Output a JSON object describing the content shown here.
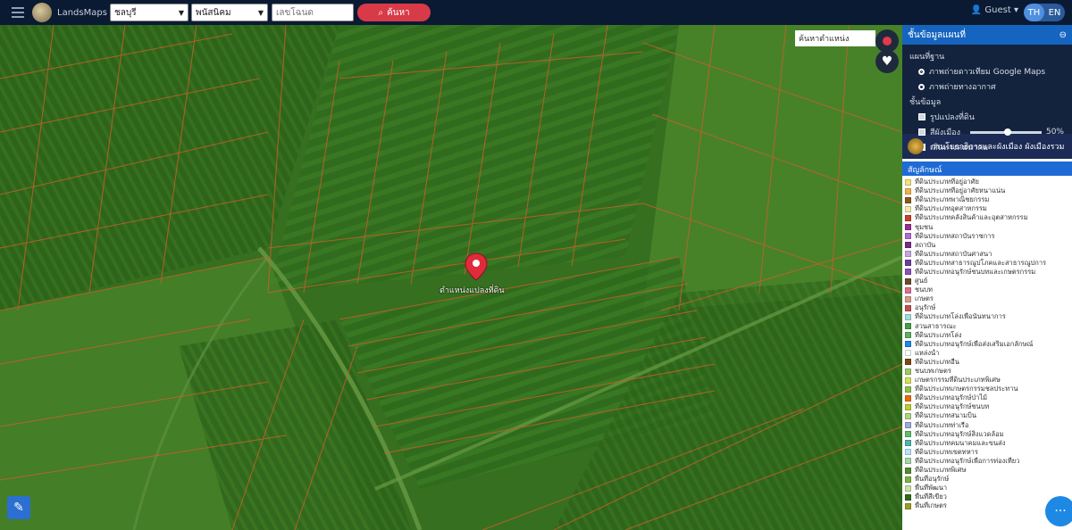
{
  "header": {
    "brand": "LandsMaps",
    "province_select": "ชลบุรี",
    "district_select": "พนัสนิคม",
    "search_placeholder": "เลขโฉนด",
    "search_button": "ค้นหา",
    "user": "Guest",
    "lang_th": "TH",
    "lang_en": "EN"
  },
  "map": {
    "map_search_text": "ค้นหาตำแหน่ง",
    "marker_label": "ตำแหน่งแปลงที่ดิน"
  },
  "panel": {
    "title": "ชั้นข้อมูลแผนที่",
    "basemap_heading": "แผนที่ฐาน",
    "basemap_options": [
      "ภาพถ่ายดาวเทียม Google Maps",
      "ภาพถ่ายทางอากาศ"
    ],
    "layer_heading": "ชั้นข้อมูล",
    "layers": [
      {
        "label": "รูปแปลงที่ดิน",
        "checked": true
      },
      {
        "label": "สีผังเมือง",
        "checked": true,
        "opacity": "50%"
      },
      {
        "label": "เส้นทางคมนาคม",
        "checked": false
      }
    ],
    "banner": "กรมโยธาธิการและผังเมือง ผังเมืองรวม",
    "legend_heading": "สัญลักษณ์",
    "legend": [
      {
        "color": "#f3e37a",
        "label": "ที่ดินประเภทที่อยู่อาศัย"
      },
      {
        "color": "#f0b24a",
        "label": "ที่ดินประเภทที่อยู่อาศัยหนาแน่น"
      },
      {
        "color": "#8a5a1c",
        "label": "ที่ดินประเภทพาณิชยกรรม"
      },
      {
        "color": "#f6e9a8",
        "label": "ที่ดินประเภทอุตสาหกรรม"
      },
      {
        "color": "#c8412b",
        "label": "ที่ดินประเภทคลังสินค้าและอุตสาหกรรม"
      },
      {
        "color": "#9b2f8f",
        "label": "ชุมชน"
      },
      {
        "color": "#b36bd1",
        "label": "ที่ดินประเภทสถาบันราชการ"
      },
      {
        "color": "#7a2a88",
        "label": "สถาบัน"
      },
      {
        "color": "#caa3e6",
        "label": "ที่ดินประเภทสถาบันศาสนา"
      },
      {
        "color": "#6b3f9c",
        "label": "ที่ดินประเภทสาธารณูปโภคและสาธารณูปการ"
      },
      {
        "color": "#8f4fc2",
        "label": "ที่ดินประเภทอนุรักษ์ชนบทและเกษตรกรรม"
      },
      {
        "color": "#6d4b2a",
        "label": "ศูนย์"
      },
      {
        "color": "#e36f8a",
        "label": "ชนบท"
      },
      {
        "color": "#d99a8a",
        "label": "เกษตร"
      },
      {
        "color": "#c65050",
        "label": "อนุรักษ์"
      },
      {
        "color": "#9be0d9",
        "label": "ที่ดินประเภทโล่งเพื่อนันทนาการ"
      },
      {
        "color": "#43a047",
        "label": "สวนสาธารณะ"
      },
      {
        "color": "#5fae5f",
        "label": "ที่ดินประเภทโล่ง"
      },
      {
        "color": "#1e88e5",
        "label": "ที่ดินประเภทอนุรักษ์เพื่อส่งเสริมเอกลักษณ์"
      },
      {
        "color": "#ffffff",
        "label": "แหล่งน้ำ"
      },
      {
        "color": "#7b4a12",
        "label": "ที่ดินประเภทอื่น"
      },
      {
        "color": "#9ccc65",
        "label": "ชนบทเกษตร"
      },
      {
        "color": "#d4e157",
        "label": "เกษตรกรรมที่ดินประเภทพิเศษ"
      },
      {
        "color": "#8bc34a",
        "label": "ที่ดินประเภทเกษตรกรรมชลประทาน"
      },
      {
        "color": "#ef6c00",
        "label": "ที่ดินประเภทอนุรักษ์ป่าไม้"
      },
      {
        "color": "#c0ca33",
        "label": "ที่ดินประเภทอนุรักษ์ชนบท"
      },
      {
        "color": "#aed581",
        "label": "ที่ดินประเภทสนามบิน"
      },
      {
        "color": "#9fa8da",
        "label": "ที่ดินประเภทท่าเรือ"
      },
      {
        "color": "#66bb6a",
        "label": "ที่ดินประเภทอนุรักษ์สิ่งแวดล้อม"
      },
      {
        "color": "#4db6ac",
        "label": "ที่ดินประเภทคมนาคมและขนส่ง"
      },
      {
        "color": "#b3e5fc",
        "label": "ที่ดินประเภทเขตทหาร"
      },
      {
        "color": "#a5d6a7",
        "label": "ที่ดินประเภทอนุรักษ์เพื่อการท่องเที่ยว"
      },
      {
        "color": "#558b2f",
        "label": "ที่ดินประเภทพิเศษ"
      },
      {
        "color": "#7cb342",
        "label": "พื้นที่อนุรักษ์"
      },
      {
        "color": "#c5e1a5",
        "label": "พื้นที่พัฒนา"
      },
      {
        "color": "#33691e",
        "label": "พื้นที่สีเขียว"
      },
      {
        "color": "#9e9d24",
        "label": "พื้นที่เกษตร"
      }
    ]
  }
}
